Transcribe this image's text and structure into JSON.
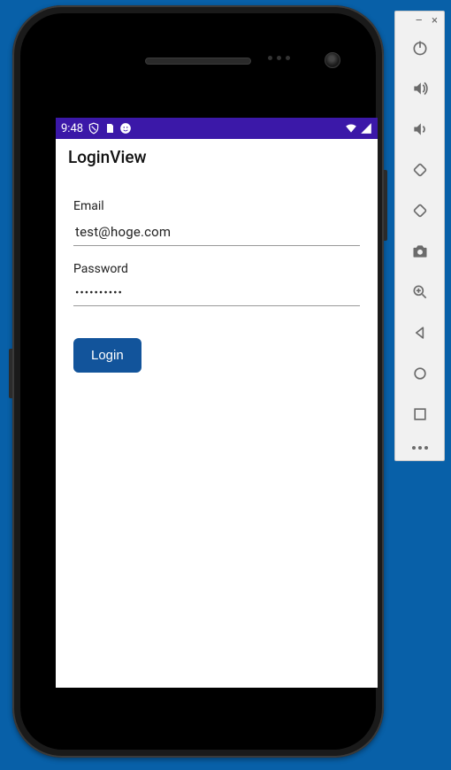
{
  "status_bar": {
    "time": "9:48",
    "icons_left": [
      "shield-icon",
      "sd-card-icon",
      "face-icon"
    ],
    "icons_right": [
      "wifi-icon",
      "signal-icon"
    ]
  },
  "app_bar": {
    "title": "LoginView"
  },
  "form": {
    "email_label": "Email",
    "email_value": "test@hoge.com",
    "password_label": "Password",
    "password_value": "••••••••••",
    "login_button": "Login"
  },
  "emulator_sidebar": {
    "minimize": "–",
    "close": "×",
    "buttons": [
      "power-icon",
      "volume-up-icon",
      "volume-down-icon",
      "rotate-left-icon",
      "rotate-right-icon",
      "camera-icon",
      "zoom-in-icon",
      "back-icon",
      "home-icon",
      "overview-icon"
    ]
  },
  "colors": {
    "background": "#0860a8",
    "status_bar": "#3b18a8",
    "login_button": "#12549b"
  }
}
